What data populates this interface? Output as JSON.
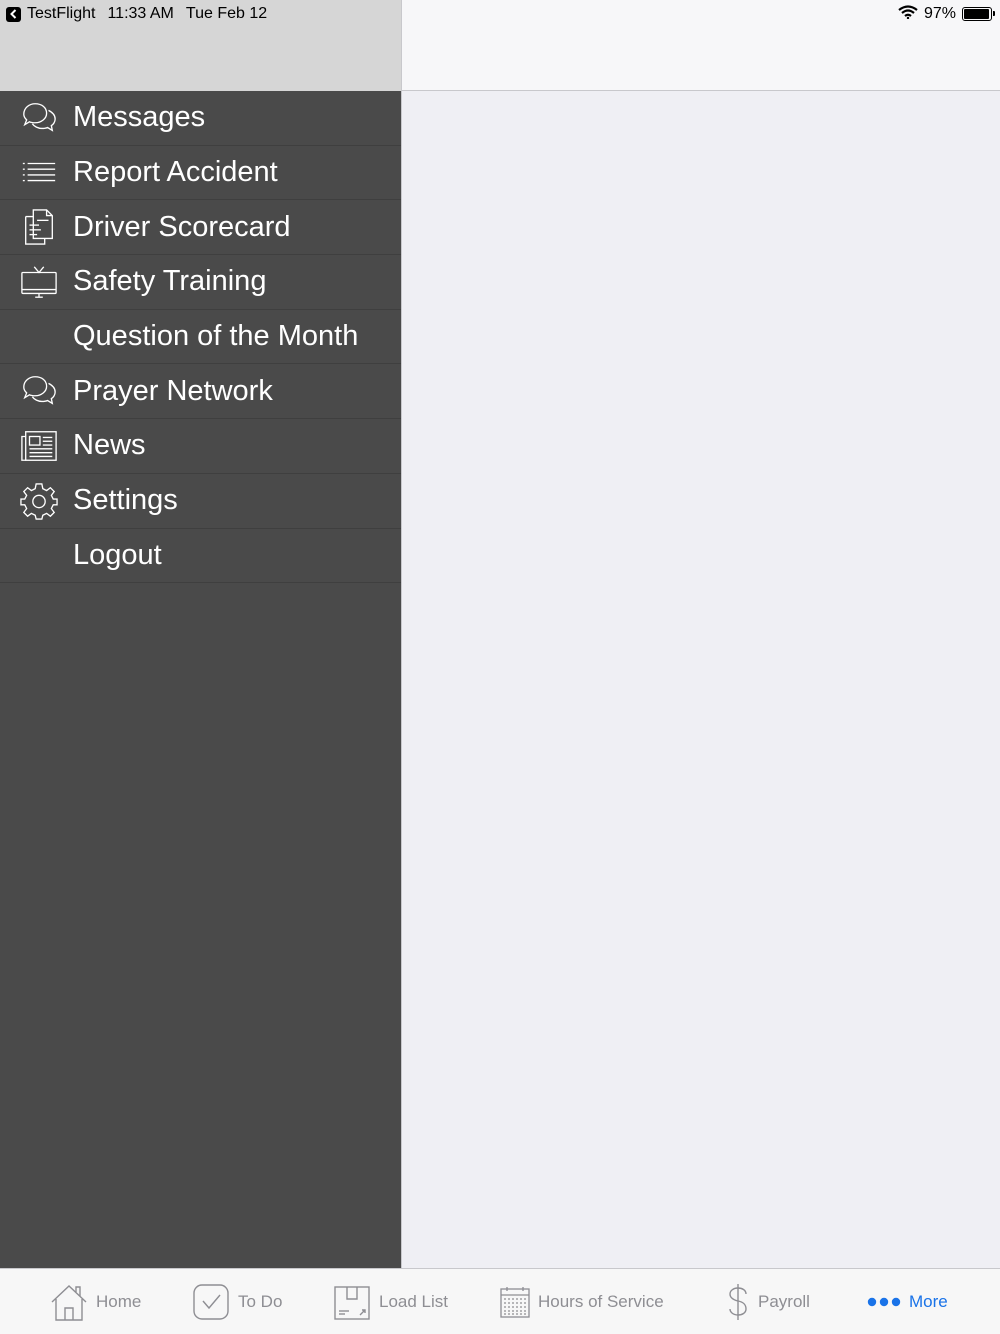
{
  "status_bar": {
    "app": "TestFlight",
    "time": "11:33 AM",
    "date": "Tue Feb 12",
    "battery": "97%",
    "battery_level": 0.97
  },
  "menu": {
    "items": [
      {
        "label": "Messages",
        "icon": "chat-bubbles-icon"
      },
      {
        "label": "Report Accident",
        "icon": "list-icon"
      },
      {
        "label": "Driver Scorecard",
        "icon": "document-icon"
      },
      {
        "label": "Safety Training",
        "icon": "tv-icon"
      },
      {
        "label": "Question of the Month",
        "icon": ""
      },
      {
        "label": "Prayer Network",
        "icon": "chat-bubbles-icon"
      },
      {
        "label": "News",
        "icon": "newspaper-icon"
      },
      {
        "label": "Settings",
        "icon": "gear-icon"
      },
      {
        "label": "Logout",
        "icon": ""
      }
    ]
  },
  "tab_bar": {
    "tabs": [
      {
        "label": "Home",
        "icon": "home-icon"
      },
      {
        "label": "To Do",
        "icon": "checkbox-icon"
      },
      {
        "label": "Load List",
        "icon": "box-icon"
      },
      {
        "label": "Hours of Service",
        "icon": "calendar-icon"
      },
      {
        "label": "Payroll",
        "icon": "dollar-icon"
      },
      {
        "label": "More",
        "icon": "more-dots-icon",
        "active": true
      }
    ],
    "active_color": "#1a73e8",
    "inactive_color": "#8e8e93"
  },
  "colors": {
    "menu_background": "#4a4a4a",
    "header_left": "#d6d6d6",
    "detail_background": "#efeff4"
  }
}
